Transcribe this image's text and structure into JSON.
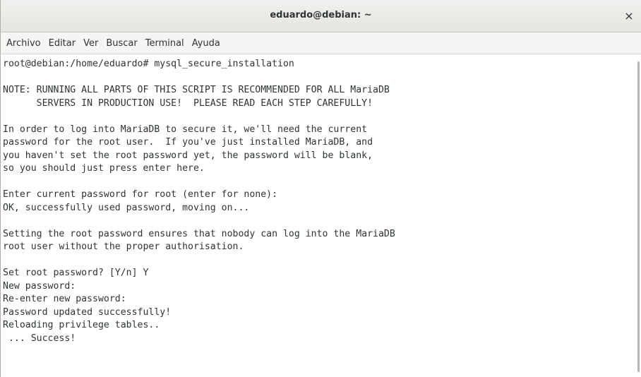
{
  "window": {
    "title": "eduardo@debian: ~",
    "close_glyph": "×"
  },
  "menu": {
    "items": [
      "Archivo",
      "Editar",
      "Ver",
      "Buscar",
      "Terminal",
      "Ayuda"
    ]
  },
  "terminal": {
    "lines": [
      "root@debian:/home/eduardo# mysql_secure_installation",
      "",
      "NOTE: RUNNING ALL PARTS OF THIS SCRIPT IS RECOMMENDED FOR ALL MariaDB",
      "      SERVERS IN PRODUCTION USE!  PLEASE READ EACH STEP CAREFULLY!",
      "",
      "In order to log into MariaDB to secure it, we'll need the current",
      "password for the root user.  If you've just installed MariaDB, and",
      "you haven't set the root password yet, the password will be blank,",
      "so you should just press enter here.",
      "",
      "Enter current password for root (enter for none):",
      "OK, successfully used password, moving on...",
      "",
      "Setting the root password ensures that nobody can log into the MariaDB",
      "root user without the proper authorisation.",
      "",
      "Set root password? [Y/n] Y",
      "New password:",
      "Re-enter new password:",
      "Password updated successfully!",
      "Reloading privilege tables..",
      " ... Success!"
    ]
  },
  "icons": {
    "close": "close-icon"
  }
}
